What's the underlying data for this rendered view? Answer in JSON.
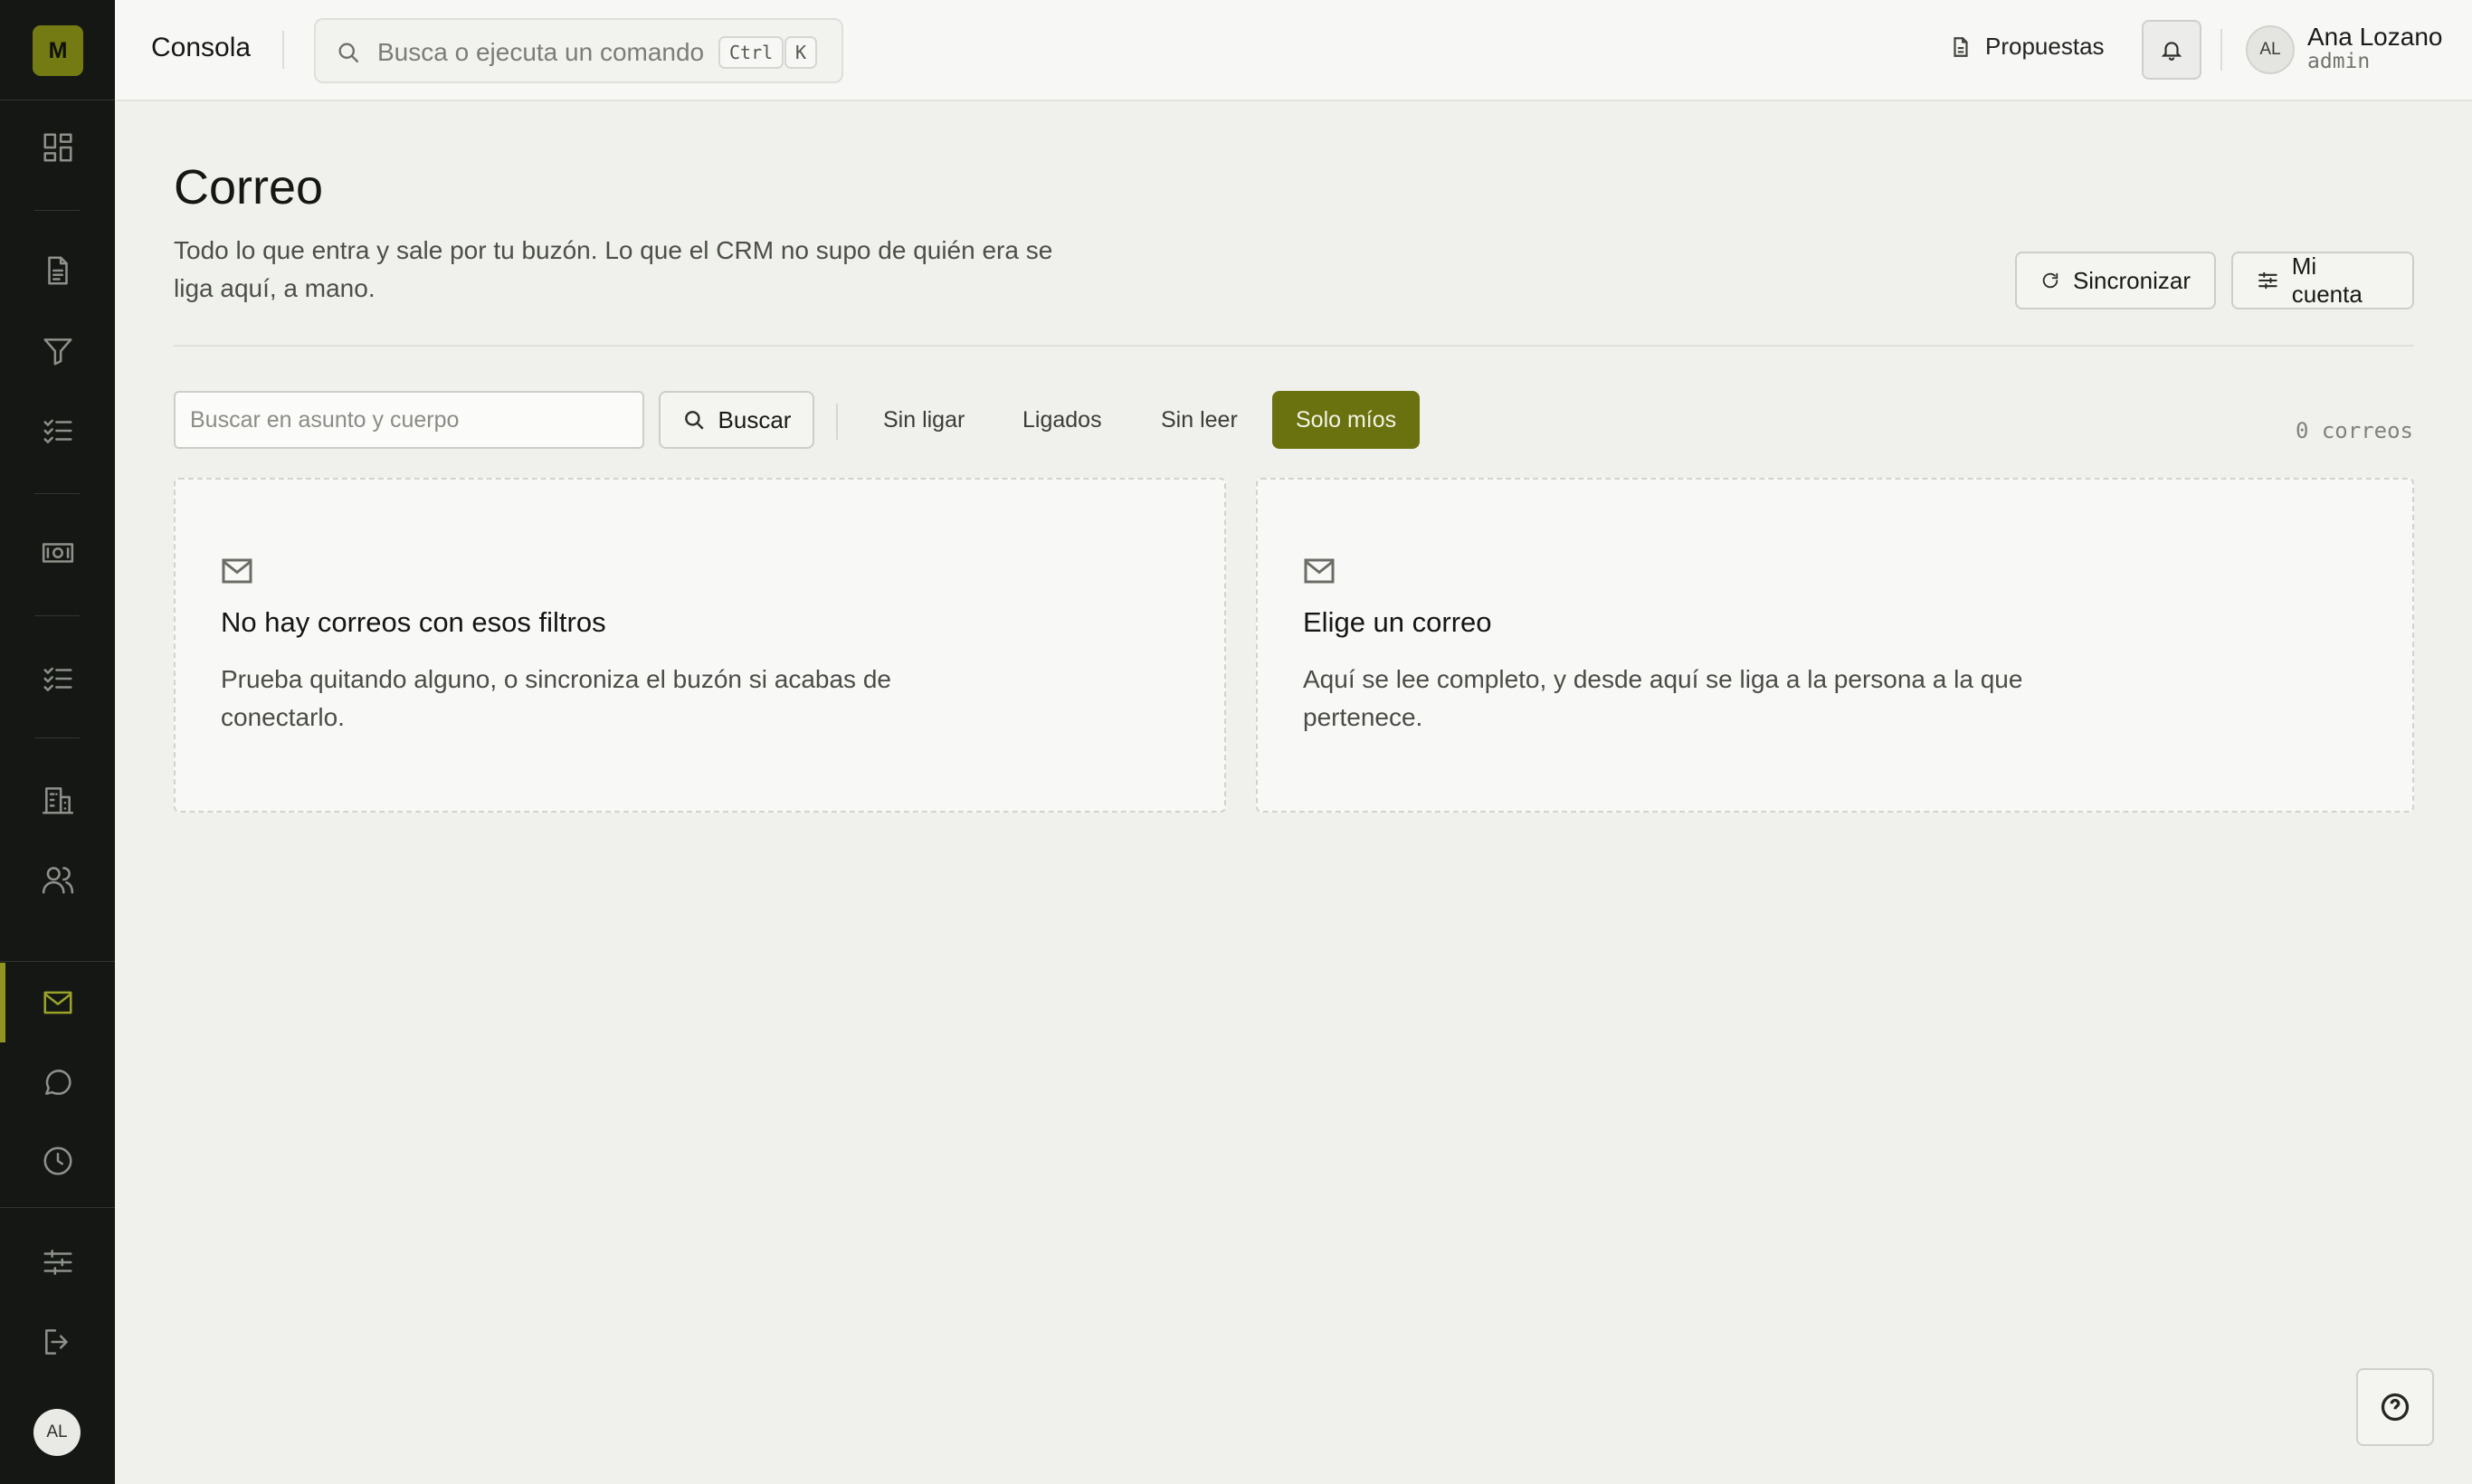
{
  "sidebar": {
    "logo_letter": "M",
    "avatar_initials": "AL",
    "items": [
      {
        "name": "dashboard",
        "icon": "dashboard-icon"
      },
      {
        "name": "documents",
        "icon": "document-icon"
      },
      {
        "name": "funnel",
        "icon": "filter-icon"
      },
      {
        "name": "tasks",
        "icon": "checklist-icon"
      },
      {
        "name": "billing",
        "icon": "banknote-icon"
      },
      {
        "name": "checklist",
        "icon": "checklist-icon"
      },
      {
        "name": "companies",
        "icon": "building-icon"
      },
      {
        "name": "contacts",
        "icon": "users-icon"
      },
      {
        "name": "mail",
        "icon": "mail-icon",
        "active": true
      },
      {
        "name": "chat",
        "icon": "chat-icon"
      },
      {
        "name": "history",
        "icon": "clock-icon"
      },
      {
        "name": "settings",
        "icon": "sliders-icon"
      },
      {
        "name": "logout",
        "icon": "logout-icon"
      }
    ],
    "accent": "#747b12"
  },
  "topbar": {
    "title": "Consola",
    "search_placeholder": "Busca o ejecuta un comando",
    "shortcut_keys": [
      "Ctrl",
      "K"
    ],
    "proposals_label": "Propuestas",
    "user": {
      "initials": "AL",
      "name": "Ana Lozano",
      "role": "admin"
    }
  },
  "main": {
    "title": "Correo",
    "subtitle": "Todo lo que entra y sale por tu buzón. Lo que el CRM no supo de quién era se liga aquí, a mano.",
    "actions": {
      "sync_label": "Sincronizar",
      "account_label": "Mi cuenta"
    },
    "filters": {
      "search_placeholder": "Buscar en asunto y cuerpo",
      "search_value": "",
      "search_button": "Buscar",
      "chips": [
        "Sin ligar",
        "Ligados",
        "Sin leer",
        "Solo míos"
      ],
      "active_chip": "Solo míos",
      "count": "0 correos"
    },
    "empty_list": {
      "title": "No hay correos con esos filtros",
      "text": "Prueba quitando alguno, o sincroniza el buzón si acabas de conectarlo."
    },
    "empty_detail": {
      "title": "Elige un correo",
      "text": "Aquí se lee completo, y desde aquí se liga a la persona a la que pertenece."
    }
  },
  "colors": {
    "primary": "#6a710f",
    "sidebar_bg": "#141714",
    "page_bg": "#f0f0ec"
  }
}
